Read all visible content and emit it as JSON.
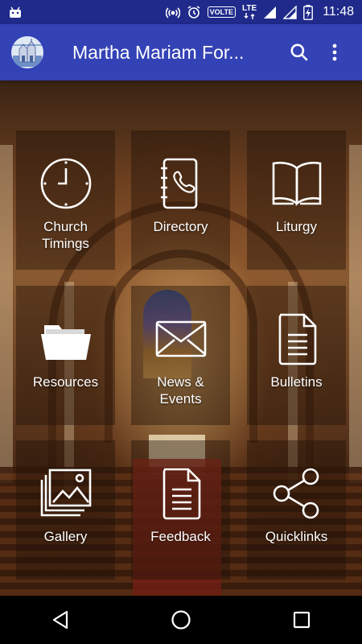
{
  "status_bar": {
    "time": "11:48",
    "volte_label": "VOLTE",
    "lte_label": "LTE",
    "icons": [
      "android-icon",
      "hotspot-icon",
      "alarm-icon",
      "volte-icon",
      "lte-icon",
      "signal-icon",
      "signal-icon",
      "battery-charging-icon"
    ]
  },
  "app_bar": {
    "title": "Martha Mariam For...",
    "logo_icon": "church-logo-icon",
    "search_icon": "search-icon",
    "menu_icon": "more-vert-icon"
  },
  "tiles": [
    {
      "label": "Church\nTimings",
      "icon": "clock-icon"
    },
    {
      "label": "Directory",
      "icon": "phone-book-icon"
    },
    {
      "label": "Liturgy",
      "icon": "open-book-icon"
    },
    {
      "label": "Resources",
      "icon": "folder-icon"
    },
    {
      "label": "News &\nEvents",
      "icon": "envelope-icon"
    },
    {
      "label": "Bulletins",
      "icon": "document-icon"
    },
    {
      "label": "Gallery",
      "icon": "photos-icon"
    },
    {
      "label": "Feedback",
      "icon": "document-icon"
    },
    {
      "label": "Quicklinks",
      "icon": "share-icon"
    }
  ],
  "nav_bar": {
    "back_icon": "back-icon",
    "home_icon": "home-icon",
    "recents_icon": "recents-icon"
  },
  "colors": {
    "status_bar": "#1f2a8a",
    "app_bar": "#3342b5",
    "tile_overlay": "rgba(30,16,8,0.42)"
  }
}
